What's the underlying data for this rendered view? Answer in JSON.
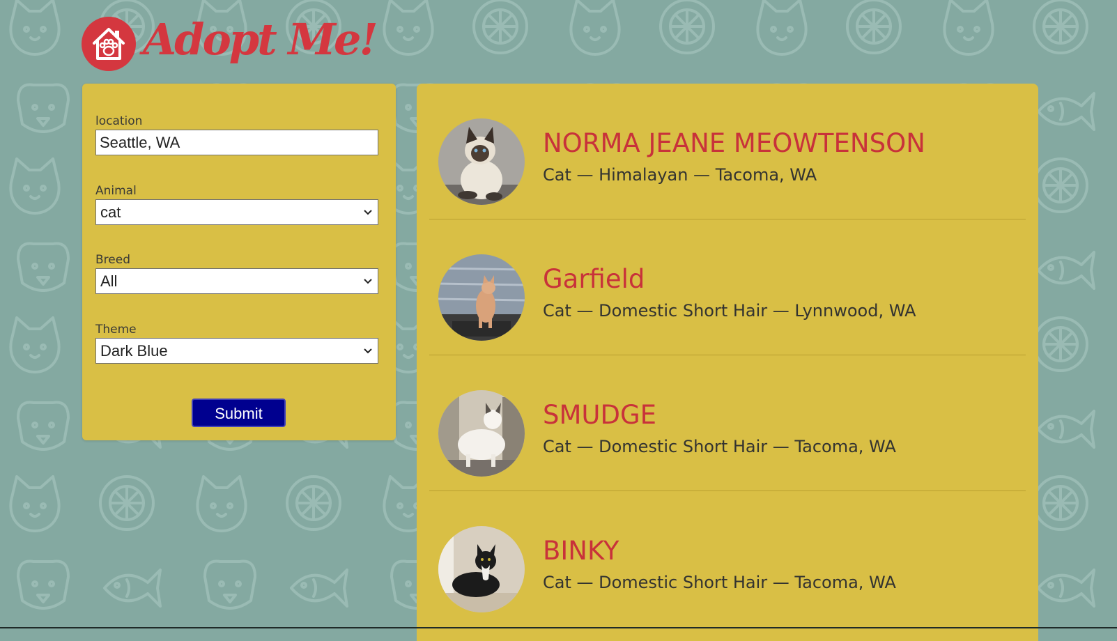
{
  "brand": {
    "title": "Adopt Me!",
    "color": "#d4373f"
  },
  "search_form": {
    "location": {
      "label": "location",
      "value": "Seattle, WA"
    },
    "animal": {
      "label": "Animal",
      "selected": "cat"
    },
    "breed": {
      "label": "Breed",
      "selected": "All"
    },
    "theme": {
      "label": "Theme",
      "selected": "Dark Blue"
    },
    "submit_label": "Submit",
    "button_color": "#00008f"
  },
  "results": [
    {
      "name": "NORMA JEANE MEOWTENSON",
      "info": "Cat — Himalayan — Tacoma, WA"
    },
    {
      "name": "Garfield",
      "info": "Cat — Domestic Short Hair — Lynnwood, WA"
    },
    {
      "name": "SMUDGE",
      "info": "Cat — Domestic Short Hair — Tacoma, WA"
    },
    {
      "name": "BINKY",
      "info": "Cat — Domestic Short Hair — Tacoma, WA"
    }
  ],
  "colors": {
    "background": "#84a9a1",
    "panel": "#d9bf45",
    "name_text": "#c8323a"
  }
}
